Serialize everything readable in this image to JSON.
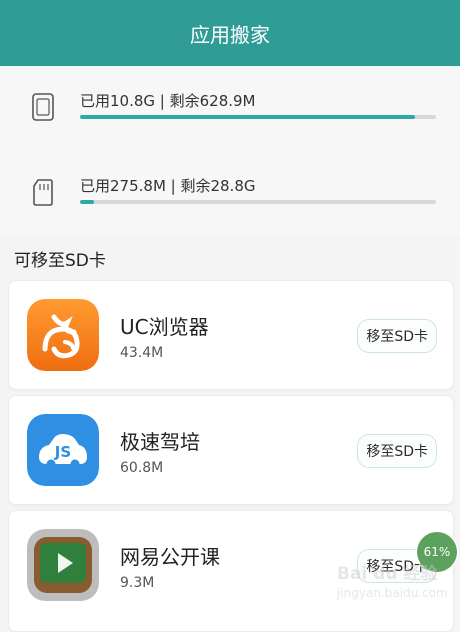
{
  "header": {
    "title": "应用搬家"
  },
  "storage": {
    "internal": {
      "icon": "phone-storage-icon",
      "label": "已用10.8G | 剩余628.9M",
      "used_fraction": 0.94
    },
    "sd": {
      "icon": "sd-card-icon",
      "label": "已用275.8M | 剩余28.8G",
      "used_fraction": 0.04
    }
  },
  "section": {
    "title": "可移至SD卡"
  },
  "apps": [
    {
      "name": "UC浏览器",
      "size": "43.4M",
      "button_label": "移至SD卡",
      "icon": "uc-browser-icon"
    },
    {
      "name": "极速驾培",
      "size": "60.8M",
      "button_label": "移至SD卡",
      "icon": "js-car-icon"
    },
    {
      "name": "网易公开课",
      "size": "9.3M",
      "button_label": "移至SD卡",
      "icon": "video-play-icon"
    }
  ],
  "badge": {
    "text": "61%"
  },
  "watermark": {
    "main": "Bai du 经验",
    "sub": "jingyan.baidu.com"
  },
  "colors": {
    "header": "#2f9c95",
    "progress": "#2faaa3",
    "uc_orange": "#f1811d",
    "js_blue": "#2f8fe2",
    "video_green": "#2f7f3d"
  }
}
